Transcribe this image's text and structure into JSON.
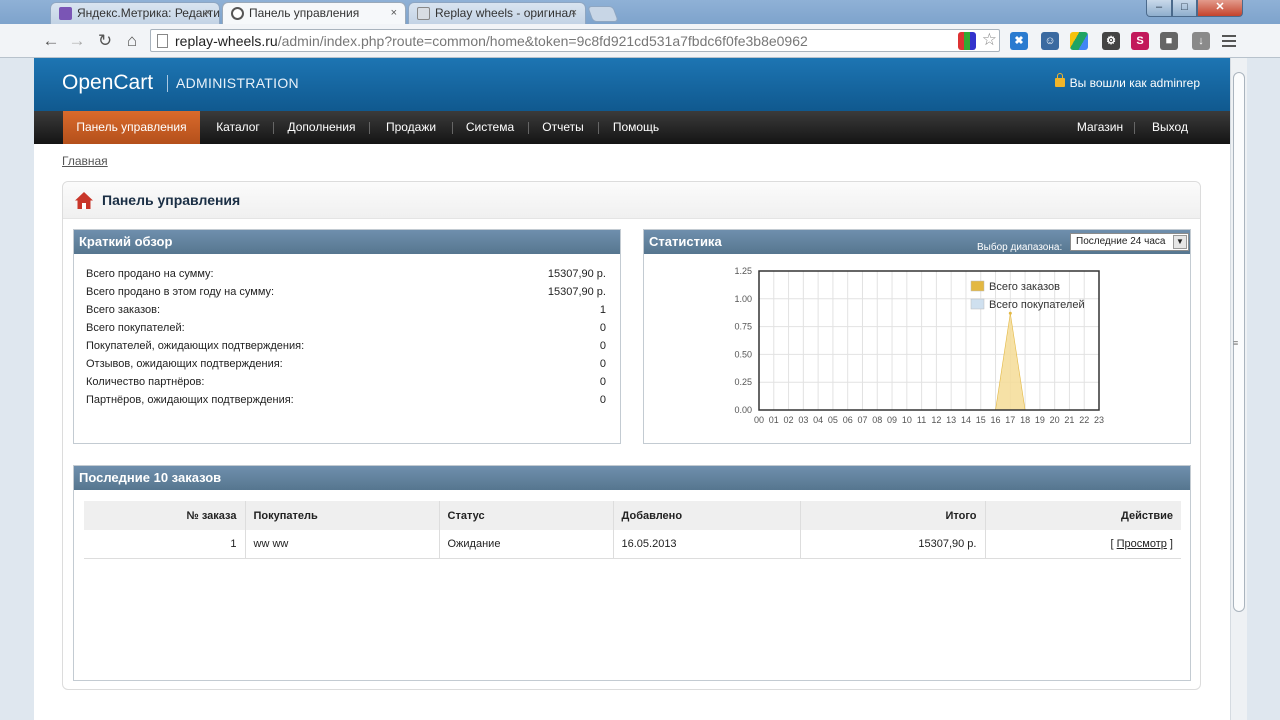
{
  "browser": {
    "tabs": [
      {
        "title": "Яндекс.Метрика: Редакти",
        "active": false
      },
      {
        "title": "Панель управления",
        "active": true
      },
      {
        "title": "Replay wheels - оригинал",
        "active": false
      }
    ],
    "tab_close": "×",
    "url_host": "replay-wheels.ru",
    "url_path": "/admin/index.php?route=common/home&token=9c8fd921cd531a7fbdc6f0fe3b8e0962",
    "win_min": "–",
    "win_max": "□",
    "win_close": "✕"
  },
  "header": {
    "logo": "OpenCart",
    "sub": "ADMINISTRATION",
    "logged_in": "Вы вошли как adminrep"
  },
  "menu": {
    "items": [
      "Панель управления",
      "Каталог",
      "Дополнения",
      "Продажи",
      "Система",
      "Отчеты",
      "Помощь"
    ],
    "right": [
      "Магазин",
      "Выход"
    ]
  },
  "breadcrumb": "Главная",
  "dashboard": {
    "title": "Панель управления",
    "overview": {
      "title": "Краткий обзор",
      "rows": [
        {
          "label": "Всего продано на сумму:",
          "value": "15307,90 р."
        },
        {
          "label": "Всего продано в этом году на сумму:",
          "value": "15307,90 р."
        },
        {
          "label": "Всего заказов:",
          "value": "1"
        },
        {
          "label": "Всего покупателей:",
          "value": "0"
        },
        {
          "label": "Покупателей, ожидающих подтверждения:",
          "value": "0"
        },
        {
          "label": "Отзывов, ожидающих подтверждения:",
          "value": "0"
        },
        {
          "label": "Количество партнёров:",
          "value": "0"
        },
        {
          "label": "Партнёров, ожидающих подтверждения:",
          "value": "0"
        }
      ]
    },
    "statistics": {
      "title": "Статистика",
      "range_label": "Выбор диапазона:",
      "range_value": "Последние 24 часа"
    },
    "orders": {
      "title": "Последние 10 заказов",
      "columns": [
        "№ заказа",
        "Покупатель",
        "Статус",
        "Добавлено",
        "Итого",
        "Действие"
      ],
      "rows": [
        {
          "id": "1",
          "customer": "ww ww",
          "status": "Ожидание",
          "date": "16.05.2013",
          "total": "15307,90 р.",
          "action_pre": "[ ",
          "action": "Просмотр",
          "action_post": " ]"
        }
      ]
    }
  },
  "chart_data": {
    "type": "area",
    "x": [
      "00",
      "01",
      "02",
      "03",
      "04",
      "05",
      "06",
      "07",
      "08",
      "09",
      "10",
      "11",
      "12",
      "13",
      "14",
      "15",
      "16",
      "17",
      "18",
      "19",
      "20",
      "21",
      "22",
      "23"
    ],
    "yticks": [
      "1.25",
      "1.00",
      "0.75",
      "0.50",
      "0.25",
      "0.00"
    ],
    "ylim": [
      0,
      1.25
    ],
    "series": [
      {
        "name": "Всего заказов",
        "color": "#f5dc96",
        "legend_color": "#e3b842",
        "values": [
          0,
          0,
          0,
          0,
          0,
          0,
          0,
          0,
          0,
          0,
          0,
          0,
          0,
          0,
          0,
          0,
          0,
          0.87,
          0,
          0,
          0,
          0,
          0,
          0
        ]
      },
      {
        "name": "Всего покупателей",
        "color": "#cfe0ef",
        "legend_color": "#cfe0ef",
        "values": [
          0,
          0,
          0,
          0,
          0,
          0,
          0,
          0,
          0,
          0,
          0,
          0,
          0,
          0,
          0,
          0,
          0,
          0,
          0,
          0,
          0,
          0,
          0,
          0
        ]
      }
    ],
    "legend": "top-right",
    "grid": true
  }
}
